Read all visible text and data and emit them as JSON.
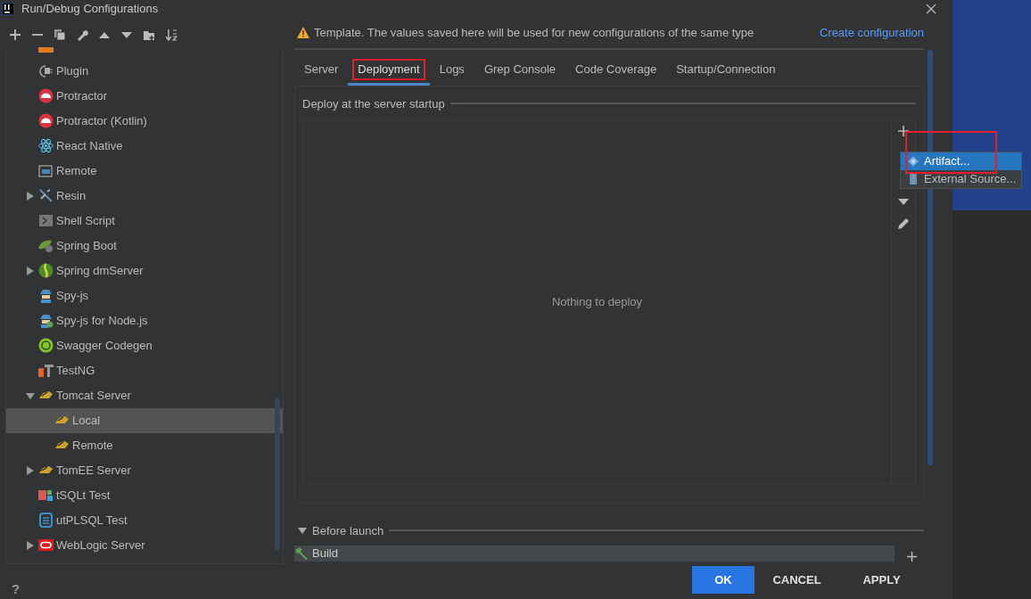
{
  "window": {
    "title": "Run/Debug Configurations"
  },
  "tree": {
    "items": [
      {
        "selected": false
      },
      {
        "label": "Plugin",
        "selected": false
      },
      {
        "label": "Protractor",
        "selected": false
      },
      {
        "label": "Protractor (Kotlin)",
        "selected": false
      },
      {
        "label": "React Native",
        "selected": false
      },
      {
        "label": "Remote",
        "selected": false
      },
      {
        "label": "Resin",
        "selected": false,
        "expanded": false
      },
      {
        "label": "Shell Script",
        "selected": false
      },
      {
        "label": "Spring Boot",
        "selected": false
      },
      {
        "label": "Spring dmServer",
        "selected": false,
        "expanded": false
      },
      {
        "label": "Spy-js",
        "selected": false
      },
      {
        "label": "Spy-js for Node.js",
        "selected": false
      },
      {
        "label": "Swagger Codegen",
        "selected": false
      },
      {
        "label": "TestNG",
        "selected": false
      },
      {
        "label": "Tomcat Server",
        "selected": false,
        "expanded": true,
        "children": [
          {
            "label": "Local",
            "selected": true
          },
          {
            "label": "Remote",
            "selected": false
          }
        ]
      },
      {
        "label": "TomEE Server",
        "selected": false,
        "expanded": false
      },
      {
        "label": "tSQLt Test",
        "selected": false
      },
      {
        "label": "utPLSQL Test",
        "selected": false
      },
      {
        "label": "WebLogic Server",
        "selected": false,
        "expanded": false
      }
    ]
  },
  "notice": {
    "text": "Template. The values saved here will be used for new configurations of the same type",
    "link": "Create configuration"
  },
  "tabs": [
    {
      "label": "Server",
      "selected": false,
      "highlighted": false
    },
    {
      "label": "Deployment",
      "selected": true,
      "highlighted": true
    },
    {
      "label": "Logs",
      "selected": false,
      "highlighted": false
    },
    {
      "label": "Grep Console",
      "selected": false,
      "highlighted": false
    },
    {
      "label": "Code Coverage",
      "selected": false,
      "highlighted": false
    },
    {
      "label": "Startup/Connection",
      "selected": false,
      "highlighted": false
    }
  ],
  "deployment": {
    "title": "Deploy at the server startup",
    "empty_text": "Nothing to deploy",
    "add_highlighted": true,
    "menu": [
      {
        "label": "Artifact...",
        "selected": true
      },
      {
        "label": "External Source...",
        "selected": false
      }
    ]
  },
  "before_launch": {
    "title": "Before launch",
    "expanded": true,
    "tasks": [
      {
        "label": "Build"
      }
    ]
  },
  "buttons": [
    {
      "label": "OK",
      "kind": "primary"
    },
    {
      "label": "CANCEL",
      "kind": "plain"
    },
    {
      "label": "APPLY",
      "kind": "plain"
    }
  ],
  "help": "?"
}
